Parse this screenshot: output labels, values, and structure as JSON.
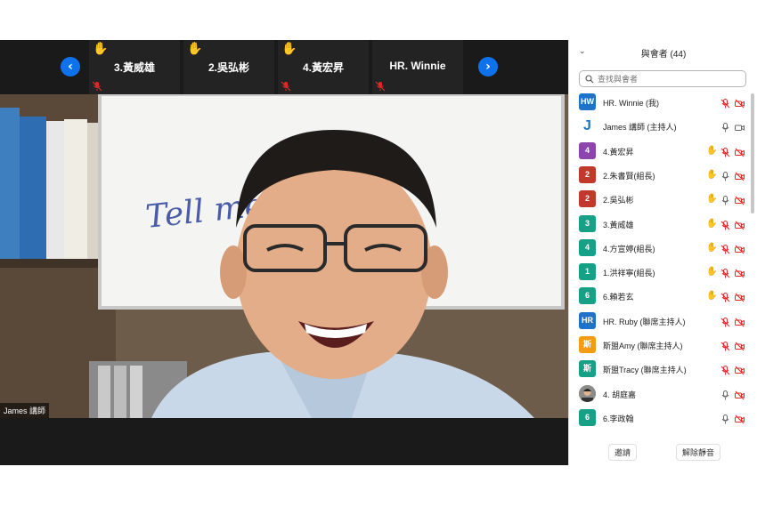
{
  "strip": {
    "prev_icon": "chevron-left-icon",
    "next_icon": "chevron-right-icon",
    "tiles": [
      {
        "name": "3.黃威雄",
        "hand": true,
        "muted": true
      },
      {
        "name": "2.吳弘彬",
        "hand": true,
        "muted": false
      },
      {
        "name": "4.黃宏昇",
        "hand": true,
        "muted": true
      },
      {
        "name": "HR. Winnie",
        "hand": false,
        "muted": true
      }
    ]
  },
  "main_video": {
    "speaker_label": "James 講師",
    "whiteboard_text": "Tell me more"
  },
  "panel": {
    "title": "與會者 (44)",
    "search_placeholder": "查找與會者",
    "invite_label": "邀請",
    "unmute_all_label": "解除靜音",
    "participants": [
      {
        "avatar": "HW",
        "color": "#1e73c8",
        "name": "HR. Winnie (我)",
        "hand": false,
        "mic": "muted",
        "cam": "off"
      },
      {
        "avatar": "J",
        "color": "logo",
        "name": "James 講師 (主持人)",
        "hand": false,
        "mic": "on",
        "cam": "on"
      },
      {
        "avatar": "4",
        "color": "#8e44ad",
        "name": "4.黃宏昇",
        "hand": true,
        "mic": "muted",
        "cam": "off"
      },
      {
        "avatar": "2",
        "color": "#c0392b",
        "name": "2.朱書賢(組長)",
        "hand": true,
        "mic": "on",
        "cam": "off"
      },
      {
        "avatar": "2",
        "color": "#c0392b",
        "name": "2.吳弘彬",
        "hand": true,
        "mic": "on",
        "cam": "off"
      },
      {
        "avatar": "3",
        "color": "#16a085",
        "name": "3.黃威雄",
        "hand": true,
        "mic": "muted",
        "cam": "off"
      },
      {
        "avatar": "4",
        "color": "#16a085",
        "name": "4.方宣婷(組長)",
        "hand": true,
        "mic": "muted",
        "cam": "off"
      },
      {
        "avatar": "1",
        "color": "#16a085",
        "name": "1.洪祥寧(組長)",
        "hand": true,
        "mic": "muted",
        "cam": "off"
      },
      {
        "avatar": "6",
        "color": "#16a085",
        "name": "6.賴若玄",
        "hand": true,
        "mic": "muted",
        "cam": "off"
      },
      {
        "avatar": "HR",
        "color": "#1e73c8",
        "name": "HR. Ruby (聯席主持人)",
        "hand": false,
        "mic": "muted",
        "cam": "off"
      },
      {
        "avatar": "斯",
        "color": "#f39c12",
        "name": "斯盟Amy (聯席主持人)",
        "hand": false,
        "mic": "muted",
        "cam": "off"
      },
      {
        "avatar": "斯",
        "color": "#16a085",
        "name": "斯盟Tracy (聯席主持人)",
        "hand": false,
        "mic": "muted",
        "cam": "off"
      },
      {
        "avatar": "",
        "color": "photo",
        "name": "4. 胡庭嘉",
        "hand": false,
        "mic": "on",
        "cam": "off"
      },
      {
        "avatar": "6",
        "color": "#16a085",
        "name": "6.李政翰",
        "hand": false,
        "mic": "on",
        "cam": "off"
      }
    ]
  },
  "colors": {
    "accent": "#0e72ed",
    "muted_red": "#e02828"
  }
}
